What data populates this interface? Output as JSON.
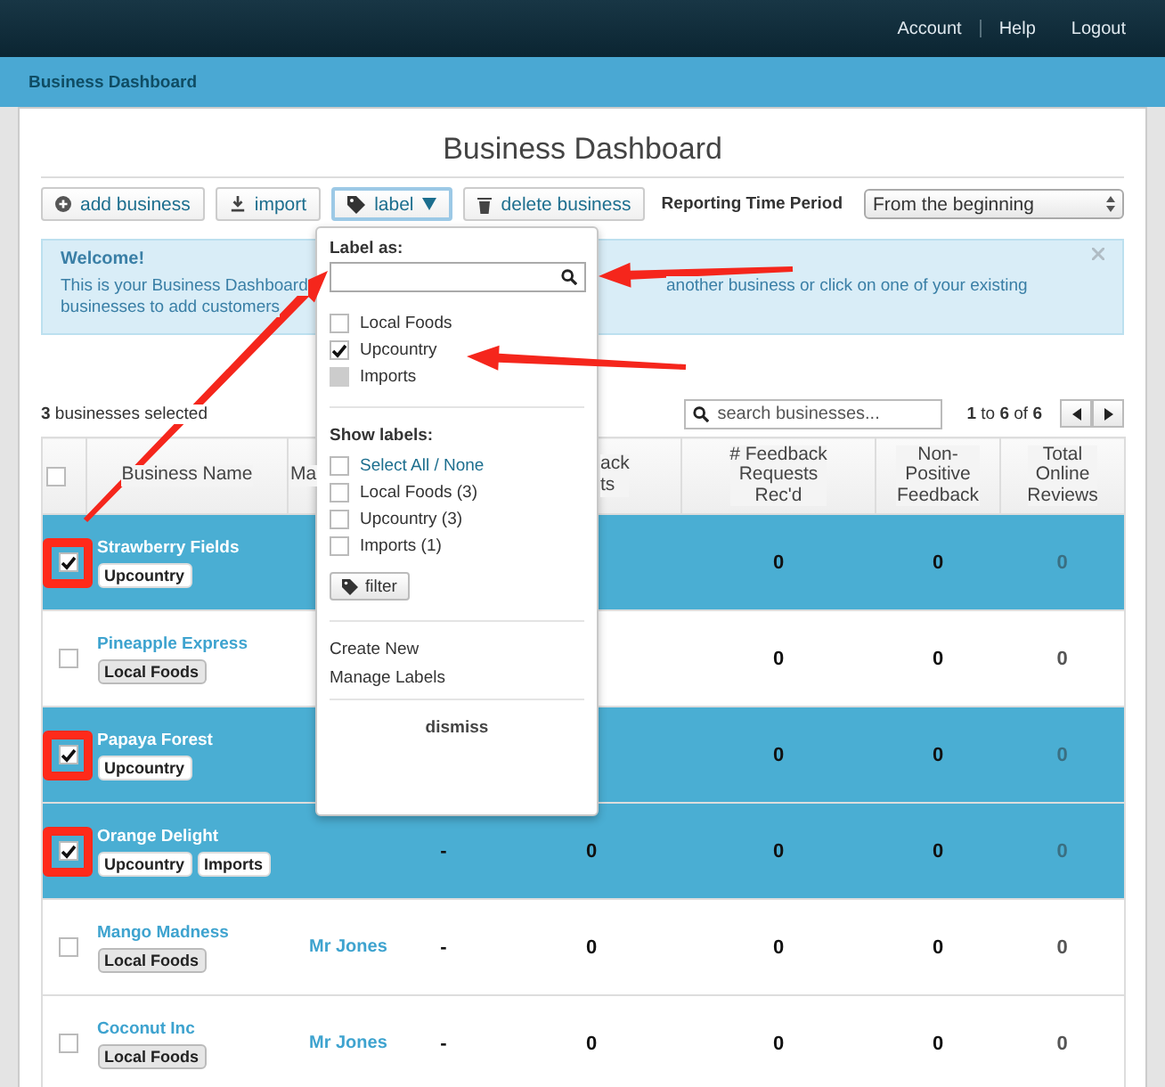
{
  "top_nav": {
    "links": [
      "Account",
      "Help",
      "Logout"
    ]
  },
  "breadcrumb": "Business Dashboard",
  "page_title": "Business Dashboard",
  "toolbar": {
    "buttons": [
      {
        "kind": "add",
        "label": "add business",
        "active": false
      },
      {
        "kind": "import",
        "label": "import",
        "active": false
      },
      {
        "kind": "label",
        "label": "label",
        "active": true
      },
      {
        "kind": "delete",
        "label": "delete business",
        "active": false
      }
    ],
    "period_label": "Reporting Time Period",
    "period_value": "From the beginning"
  },
  "welcome": {
    "title": "Welcome!",
    "text_parts": [
      "This is your Business Dashboard",
      "another business or click on one of your existing",
      "businesses to add customers"
    ]
  },
  "selection_count": "**3** businesses selected",
  "search": {
    "placeholder": "search businesses..."
  },
  "pager": "**1** to **6** of **6**",
  "label_menu": {
    "label_as": "Label as:",
    "options": [
      {
        "label": "Local Foods",
        "checked": false,
        "mixed": false
      },
      {
        "label": "Upcountry",
        "checked": true,
        "mixed": false
      },
      {
        "label": "Imports",
        "checked": false,
        "mixed": true
      }
    ],
    "show_labels_title": "Show labels:",
    "show_labels": [
      {
        "label": "Select All / None",
        "kind": "link",
        "checked": false
      },
      {
        "label": "Local Foods (3)",
        "kind": "plain",
        "checked": false
      },
      {
        "label": "Upcountry (3)",
        "kind": "plain",
        "checked": false
      },
      {
        "label": "Imports (1)",
        "kind": "plain",
        "checked": false
      }
    ],
    "filter_button": "filter",
    "actions": [
      "Create New",
      "Manage Labels"
    ],
    "dismiss": "dismiss"
  },
  "table": {
    "header_checked": false,
    "columns": [
      {
        "kind": "name",
        "lines": [
          "Business Name"
        ]
      },
      {
        "kind": "cut",
        "lines": [
          "Ma"
        ]
      },
      {
        "kind": "hidden"
      },
      {
        "kind": "cut_right",
        "lines": [
          "ack",
          "ts"
        ]
      },
      {
        "kind": "plain",
        "lines": [
          "# Feedback",
          "Requests",
          "Rec'd"
        ]
      },
      {
        "kind": "plain",
        "lines": [
          "Non-",
          "Positive",
          "Feedback"
        ]
      },
      {
        "kind": "plain",
        "lines": [
          "Total",
          "Online",
          "Reviews"
        ]
      }
    ],
    "rows": [
      {
        "name": "Strawberry Fields",
        "labels": [
          "Upcountry"
        ],
        "selected": true,
        "marked": true,
        "feedback_recd": "0",
        "non_positive": "0",
        "online_reviews": "0"
      },
      {
        "name": "Pineapple Express",
        "labels": [
          "Local Foods"
        ],
        "selected": false,
        "marked": false,
        "feedback_recd": "0",
        "non_positive": "0",
        "online_reviews": "0"
      },
      {
        "name": "Papaya Forest",
        "labels": [
          "Upcountry"
        ],
        "selected": true,
        "marked": true,
        "feedback_recd": "0",
        "non_positive": "0",
        "online_reviews": "0"
      },
      {
        "name": "Orange Delight",
        "labels": [
          "Upcountry",
          "Imports"
        ],
        "selected": true,
        "marked": true,
        "column_3": "-",
        "column_4": "0",
        "feedback_recd": "0",
        "non_positive": "0",
        "online_reviews": "0"
      },
      {
        "name": "Mango Madness",
        "labels": [
          "Local Foods"
        ],
        "selected": false,
        "marked": false,
        "manager": "Mr Jones",
        "column_3": "-",
        "column_4": "0",
        "feedback_recd": "0",
        "non_positive": "0",
        "online_reviews": "0"
      },
      {
        "name": "Coconut Inc",
        "labels": [
          "Local Foods"
        ],
        "selected": false,
        "marked": false,
        "manager": "Mr Jones",
        "column_3": "-",
        "column_4": "0",
        "feedback_recd": "0",
        "non_positive": "0",
        "online_reviews": "0"
      }
    ]
  }
}
